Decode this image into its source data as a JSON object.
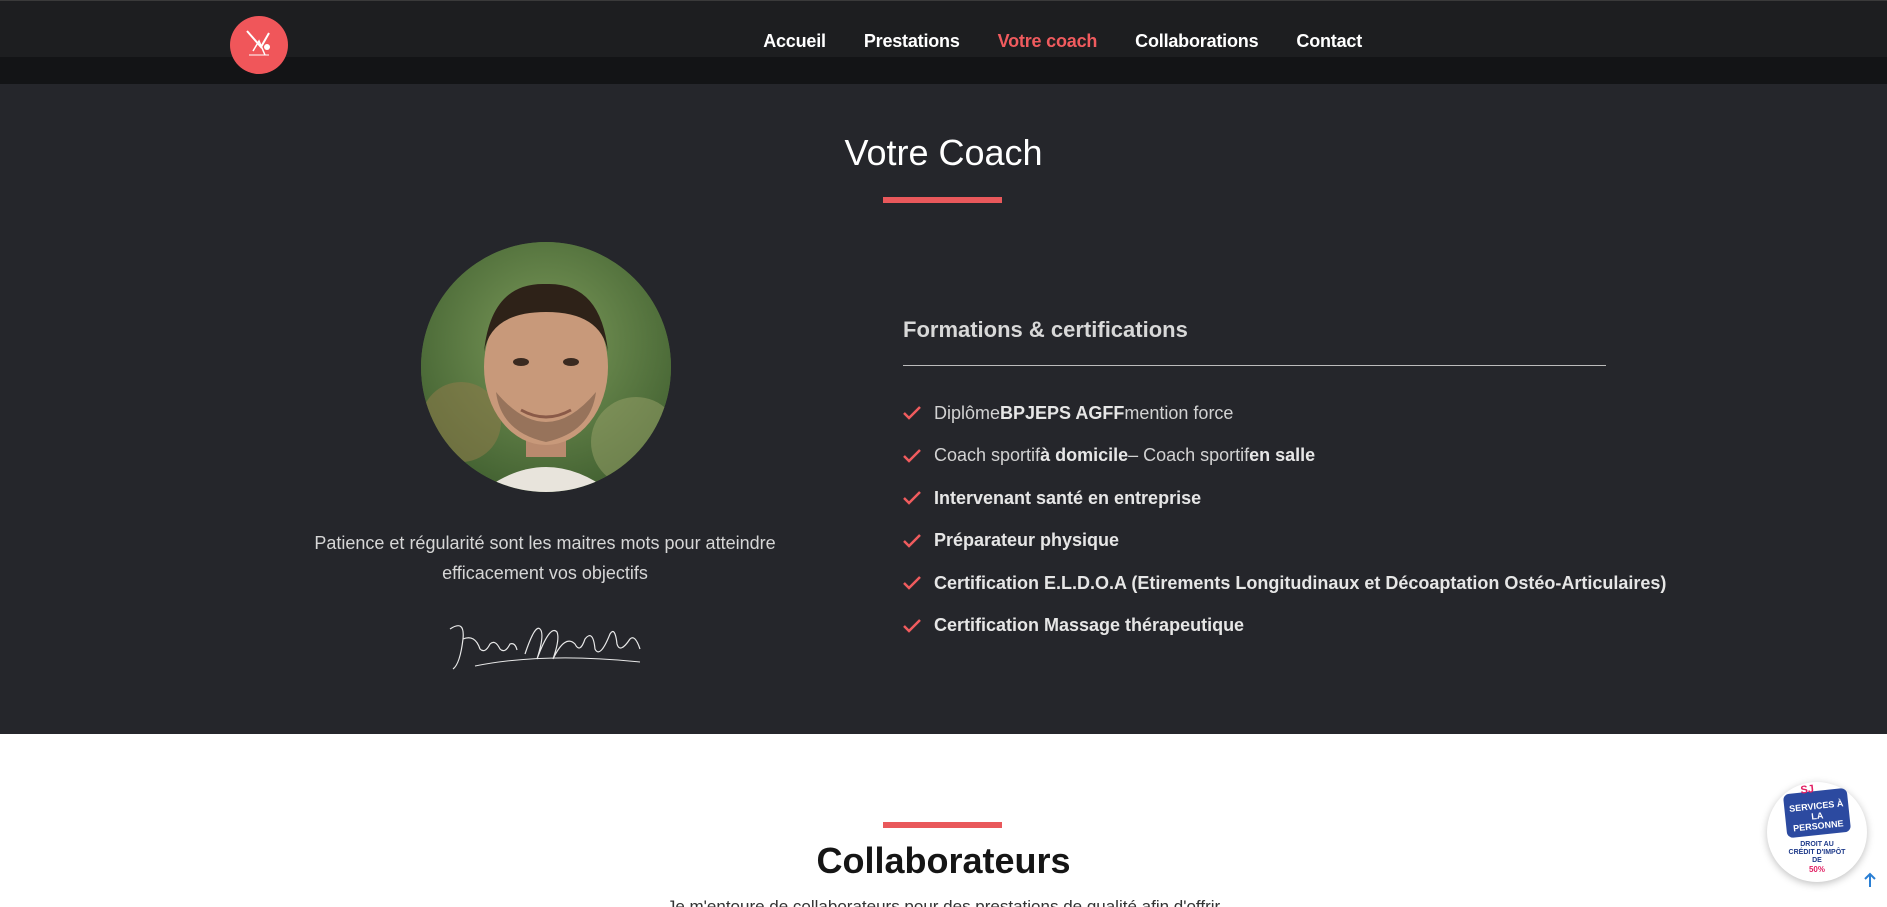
{
  "nav": {
    "items": [
      {
        "label": "Accueil"
      },
      {
        "label": "Prestations"
      },
      {
        "label": "Votre coach"
      },
      {
        "label": "Collaborations"
      },
      {
        "label": "Contact"
      }
    ],
    "active_index": 2
  },
  "coach": {
    "title": "Votre Coach",
    "quote": "Patience et régularité sont les maitres mots pour atteindre efficacement vos objectifs",
    "signature_text": "Yoann Mozzechinde"
  },
  "formations": {
    "title": "Formations & certifications",
    "items": [
      {
        "pre": "Diplôme ",
        "bold": "BPJEPS AGFF",
        "post": " mention force"
      },
      {
        "pre": "Coach sportif ",
        "bold": "à domicile",
        "mid": " – Coach sportif ",
        "bold2": "en salle"
      },
      {
        "bold": "Intervenant santé en entreprise"
      },
      {
        "bold": "Préparateur physique"
      },
      {
        "bold": "Certification E.L.D.O.A (Etirements Longitudinaux et Décoaptation Ostéo-Articulaires)"
      },
      {
        "bold": "Certification Massage thérapeutique"
      }
    ]
  },
  "collab": {
    "title": "Collaborateurs",
    "subtitle": "Je m'entoure de collaborateurs pour des prestations de qualité afin d'offrir"
  },
  "badge": {
    "sj": "SJ",
    "line1": "SERVICES À",
    "line2": "LA PERSONNE",
    "text": "DROIT AU CRÉDIT D'IMPÔT DE",
    "pct": "50%"
  },
  "colors": {
    "accent": "#f05b5e",
    "dark_bg": "#25262b",
    "header_bg": "#131416"
  }
}
